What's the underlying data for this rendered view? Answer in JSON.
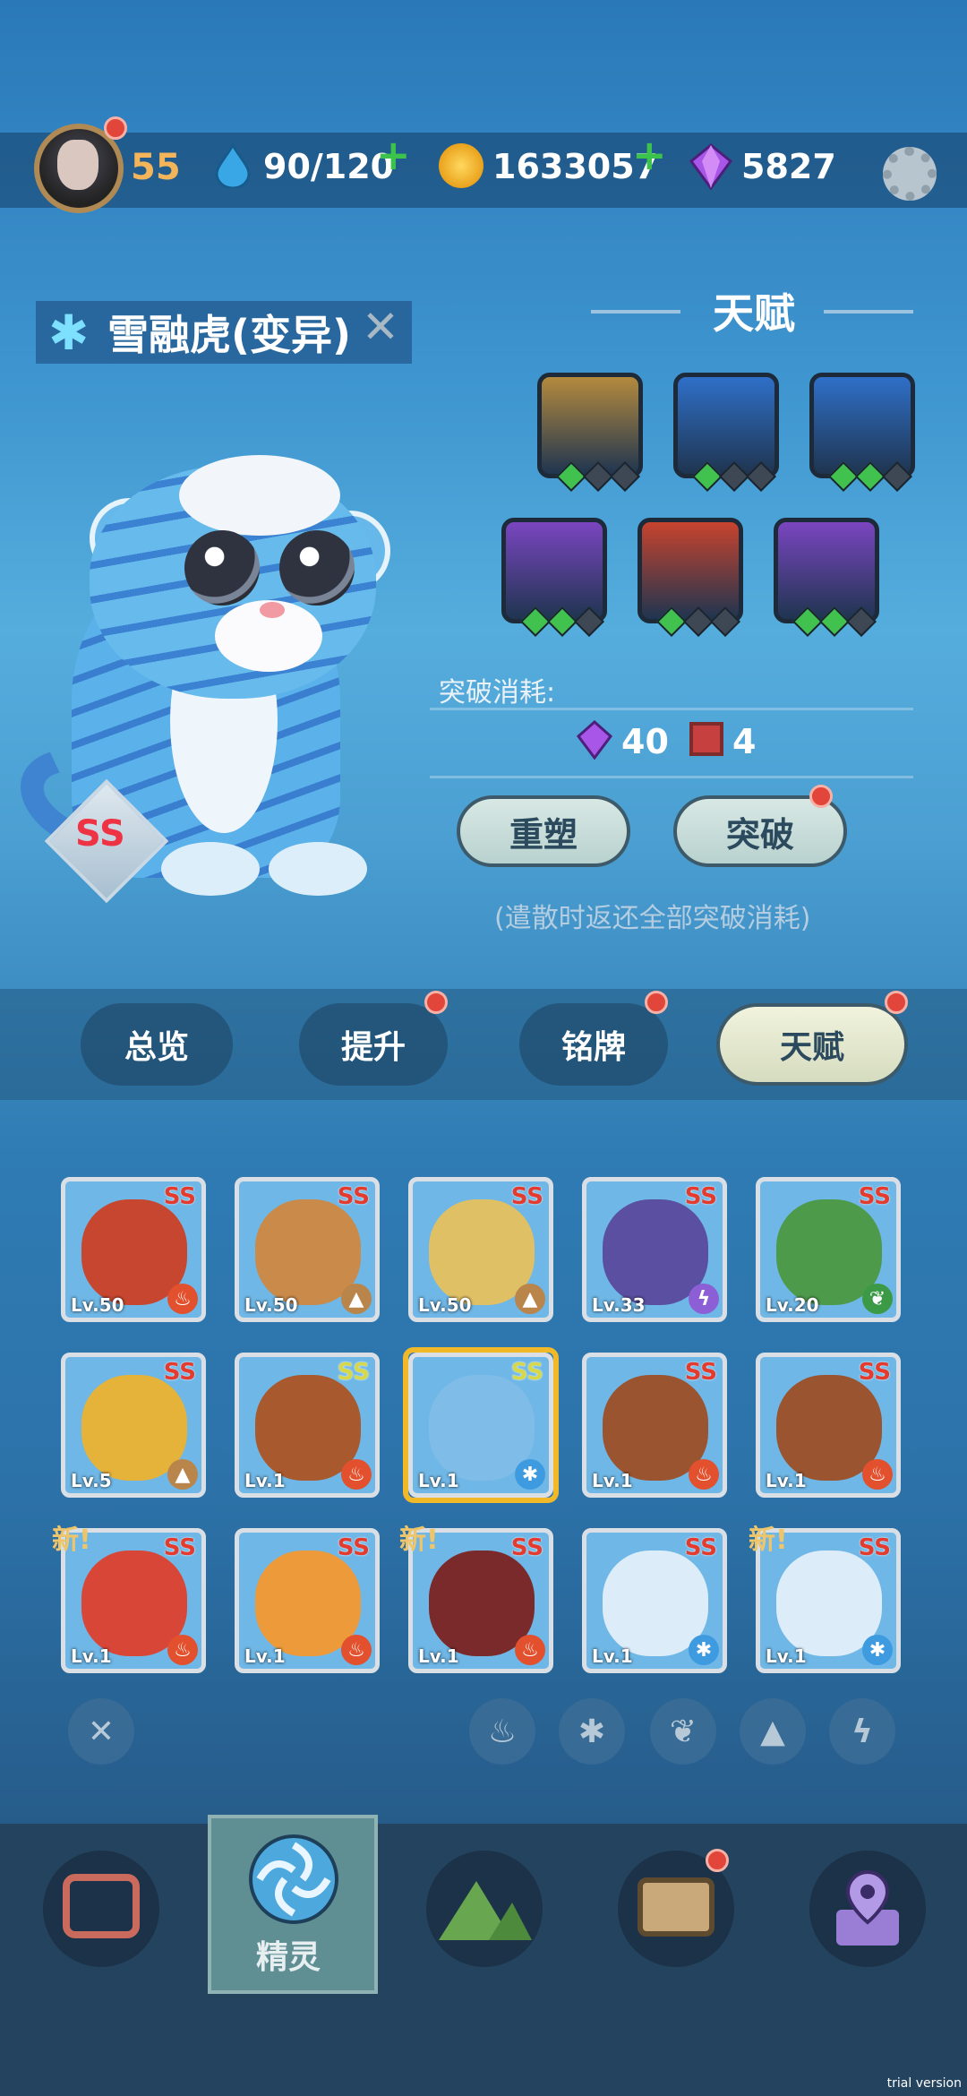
{
  "status": {
    "level": "55",
    "stamina": "90/120",
    "coins": "1633057",
    "gems": "5827"
  },
  "pet": {
    "name": "雪融虎(变异)",
    "rarity": "SS"
  },
  "talent": {
    "title": "天赋",
    "icons": [
      {
        "name": "talent-1",
        "color": "#b48a3d",
        "pips": [
          1,
          0,
          0
        ]
      },
      {
        "name": "talent-2",
        "color": "#2f6fc8",
        "pips": [
          1,
          0,
          0
        ]
      },
      {
        "name": "talent-3",
        "color": "#2f6fc8",
        "pips": [
          1,
          1,
          0
        ]
      },
      {
        "name": "talent-4",
        "color": "#7a45c0",
        "pips": [
          1,
          1,
          0
        ]
      },
      {
        "name": "talent-5",
        "color": "#c7432e",
        "pips": [
          1,
          0,
          0
        ]
      },
      {
        "name": "talent-6",
        "color": "#7a45c0",
        "pips": [
          1,
          1,
          0
        ]
      }
    ],
    "cost_label": "突破消耗:",
    "cost_gem": "40",
    "cost_item": "4",
    "reshape_label": "重塑",
    "breakthrough_label": "突破",
    "note": "(遣散时返还全部突破消耗)"
  },
  "tabs": [
    {
      "label": "总览",
      "active": false,
      "dot": false
    },
    {
      "label": "提升",
      "active": false,
      "dot": true
    },
    {
      "label": "铭牌",
      "active": false,
      "dot": true
    },
    {
      "label": "天赋",
      "active": true,
      "dot": true
    }
  ],
  "grid": [
    {
      "lv": "Lv.50",
      "rank": "SS",
      "color": "#c6462f",
      "el": "fire"
    },
    {
      "lv": "Lv.50",
      "rank": "SS",
      "color": "#c98a4a",
      "el": "earth"
    },
    {
      "lv": "Lv.50",
      "rank": "SS",
      "color": "#e0c065",
      "el": "earth"
    },
    {
      "lv": "Lv.33",
      "rank": "SS",
      "color": "#5a4fa0",
      "el": "thunder"
    },
    {
      "lv": "Lv.20",
      "rank": "SS",
      "color": "#4c9a4a",
      "el": "leaf"
    },
    {
      "lv": "Lv.5",
      "rank": "SS",
      "color": "#e5b23a",
      "el": "earth"
    },
    {
      "lv": "Lv.1",
      "rank": "SS",
      "color": "#a85a2e",
      "el": "fire"
    },
    {
      "lv": "Lv.1",
      "rank": "SS",
      "color": "#7fbde8",
      "el": "ice"
    },
    {
      "lv": "Lv.1",
      "rank": "SS",
      "color": "#9a5430",
      "el": "fire"
    },
    {
      "lv": "Lv.1",
      "rank": "SS",
      "color": "#9a5430",
      "el": "fire"
    },
    {
      "lv": "Lv.1",
      "rank": "SS",
      "color": "#d84638",
      "el": "fire"
    },
    {
      "lv": "Lv.1",
      "rank": "SS",
      "color": "#ec9a3a",
      "el": "fire"
    },
    {
      "lv": "Lv.1",
      "rank": "SS",
      "color": "#7a2a2a",
      "el": "fire"
    },
    {
      "lv": "Lv.1",
      "rank": "SS",
      "color": "#dcecf8",
      "el": "ice"
    },
    {
      "lv": "Lv.1",
      "rank": "SS",
      "color": "#dcecf8",
      "el": "ice"
    }
  ],
  "new_badge": "新!",
  "nav": {
    "active_label": "精灵"
  },
  "watermark": "trial version",
  "colors": {
    "red_dot": "#e2463b",
    "gold": "#f3b45a",
    "green_plus": "#3cc34b"
  }
}
